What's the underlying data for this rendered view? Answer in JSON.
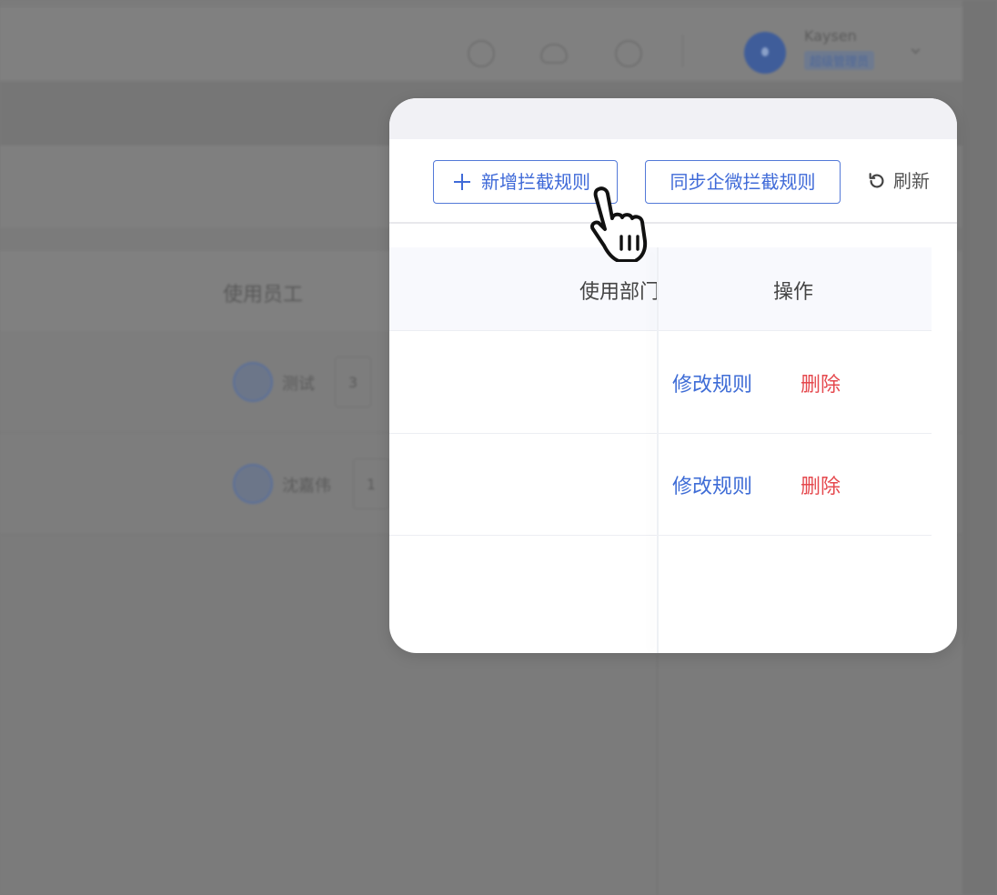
{
  "background": {
    "user_name": "Kaysen",
    "user_role": "超级管理员",
    "column_title": "使用员工",
    "rows": [
      {
        "name": "测试",
        "count": "3"
      },
      {
        "name": "沈嘉伟",
        "count": "1"
      }
    ]
  },
  "toolbar": {
    "add_rule_label": "新增拦截规则",
    "sync_rule_label": "同步企微拦截规则",
    "refresh_label": "刷新"
  },
  "table": {
    "columns": [
      "使用部门",
      "操作"
    ],
    "rows": [
      {
        "edit_label": "修改规则",
        "delete_label": "删除"
      },
      {
        "edit_label": "修改规则",
        "delete_label": "删除"
      }
    ]
  },
  "colors": {
    "primary": "#3f6ad8",
    "danger": "#e5484d",
    "overlay": "#7a7a7a"
  },
  "icons": [
    "plus-icon",
    "refresh-icon",
    "hand-pointer-icon",
    "help-icon",
    "cloud-download-icon",
    "notification-icon",
    "avatar-icon",
    "chevron-down-icon"
  ]
}
